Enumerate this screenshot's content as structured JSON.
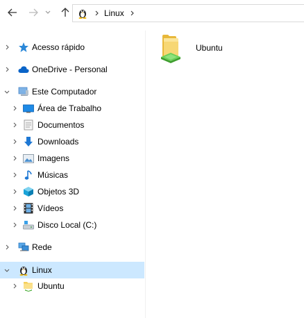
{
  "address_bar": {
    "crumbs": [
      "Linux"
    ]
  },
  "nav": {
    "quick_access": "Acesso rápido",
    "onedrive": "OneDrive - Personal",
    "this_pc": "Este Computador",
    "desktop": "Área de Trabalho",
    "documents": "Documentos",
    "downloads": "Downloads",
    "pictures": "Imagens",
    "music": "Músicas",
    "objects3d": "Objetos 3D",
    "videos": "Vídeos",
    "local_disk": "Disco Local (C:)",
    "network": "Rede",
    "linux": "Linux",
    "ubuntu": "Ubuntu"
  },
  "content": {
    "items": [
      {
        "name": "Ubuntu",
        "icon": "linux-distro-folder-icon"
      }
    ]
  },
  "colors": {
    "selection": "#cce8ff",
    "accent_blue": "#0078d7"
  }
}
